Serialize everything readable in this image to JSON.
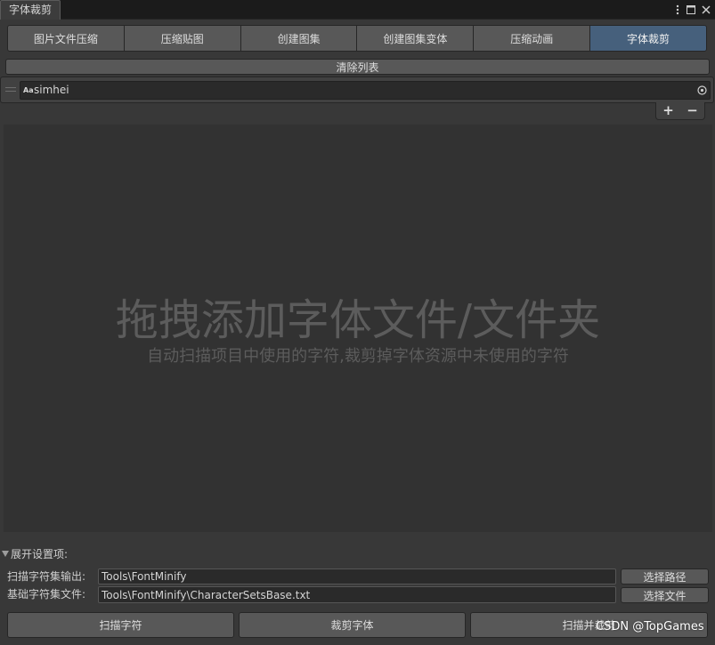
{
  "window": {
    "tab_title": "字体裁剪",
    "controls": [
      {
        "icon": "more-vert-icon"
      },
      {
        "icon": "maximize-icon"
      },
      {
        "icon": "close-icon"
      }
    ]
  },
  "toolbar": {
    "tabs": [
      {
        "label": "图片文件压缩",
        "selected": false
      },
      {
        "label": "压缩贴图",
        "selected": false
      },
      {
        "label": "创建图集",
        "selected": false
      },
      {
        "label": "创建图集变体",
        "selected": false
      },
      {
        "label": "压缩动画",
        "selected": false
      },
      {
        "label": "字体裁剪",
        "selected": true
      }
    ]
  },
  "font_list": {
    "clear_label": "清除列表",
    "items": [
      {
        "icon": "font-asset-icon",
        "icon_glyph": "Aa",
        "name": "simhei"
      }
    ],
    "add_label": "+",
    "remove_label": "−"
  },
  "drop_area": {
    "title": "拖拽添加字体文件/文件夹",
    "subtitle": "自动扫描项目中使用的字符,裁剪掉字体资源中未使用的字符"
  },
  "settings": {
    "foldout_label": "展开设置项:",
    "expanded": true,
    "rows": [
      {
        "label": "扫描字符集输出:",
        "value": "Tools\\FontMinify",
        "button_label": "选择路径"
      },
      {
        "label": "基础字符集文件:",
        "value": "Tools\\FontMinify\\CharacterSetsBase.txt",
        "button_label": "选择文件"
      }
    ]
  },
  "actions": {
    "scan_label": "扫描字符",
    "trim_label": "裁剪字体",
    "scan_and_trim_label": "扫描并裁剪"
  },
  "watermark": "CSDN @TopGames",
  "colors": {
    "window_bg": "#383838",
    "selected_tab": "#46607c",
    "button": "#585858",
    "field": "#2a2a2a",
    "drop_area_bg": "#323232",
    "drop_text": "#5c5c5c"
  }
}
